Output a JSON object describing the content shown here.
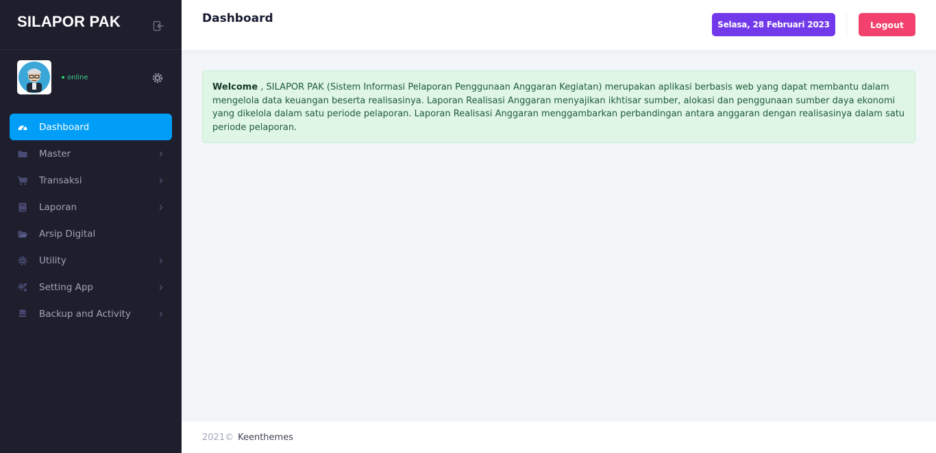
{
  "app": {
    "brand": "SILAPOR PAK"
  },
  "user": {
    "status": "online"
  },
  "sidebar": {
    "items": [
      {
        "label": "Dashboard",
        "icon": "gauge-icon",
        "active": true,
        "has_submenu": false
      },
      {
        "label": "Master",
        "icon": "folder-icon",
        "active": false,
        "has_submenu": true
      },
      {
        "label": "Transaksi",
        "icon": "cart-icon",
        "active": false,
        "has_submenu": true
      },
      {
        "label": "Laporan",
        "icon": "book-icon",
        "active": false,
        "has_submenu": true
      },
      {
        "label": "Arsip Digital",
        "icon": "folder-open-icon",
        "active": false,
        "has_submenu": false
      },
      {
        "label": "Utility",
        "icon": "gear-icon",
        "active": false,
        "has_submenu": true
      },
      {
        "label": "Setting App",
        "icon": "gears-icon",
        "active": false,
        "has_submenu": true
      },
      {
        "label": "Backup and Activity",
        "icon": "database-icon",
        "active": false,
        "has_submenu": true
      }
    ]
  },
  "header": {
    "title": "Dashboard",
    "date": "Selasa, 28 Februari 2023",
    "logout_label": "Logout"
  },
  "alert": {
    "lead": "Welcome",
    "text": " , SILAPOR PAK (Sistem Informasi Pelaporan Penggunaan Anggaran Kegiatan) merupakan aplikasi berbasis web yang dapat membantu dalam mengelola data keuangan beserta realisasinya. Laporan Realisasi Anggaran menyajikan ikhtisar sumber, alokasi dan penggunaan sumber daya ekonomi yang dikelola dalam satu periode pelaporan. Laporan Realisasi Anggaran menggambarkan perbandingan antara anggaran dengan realisasinya dalam satu periode pelaporan."
  },
  "footer": {
    "year": "2021©",
    "link": "Keenthemes"
  },
  "colors": {
    "sidebar_bg": "#1e1e2d",
    "active_item": "#009ef7",
    "date_badge": "#7239ea",
    "logout": "#f1416c",
    "alert_bg": "#dff5e6",
    "online": "#3ecf8e"
  }
}
